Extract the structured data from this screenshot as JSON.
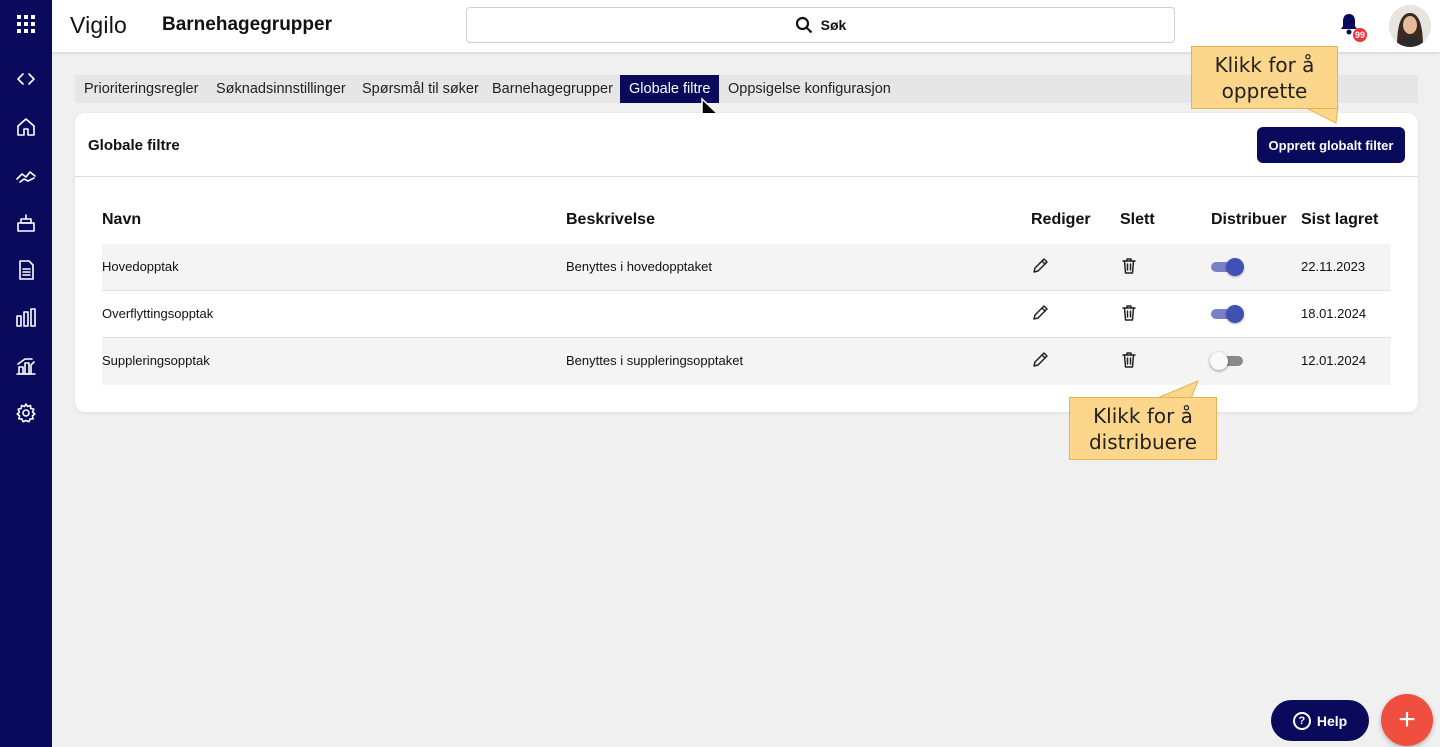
{
  "app": {
    "logo": "Vigilo",
    "page_title": "Barnehagegrupper"
  },
  "search": {
    "label": "Søk"
  },
  "notifications": {
    "count": "99"
  },
  "tabs": [
    {
      "label": "Prioriteringsregler",
      "active": false
    },
    {
      "label": "Søknadsinnstillinger",
      "active": false
    },
    {
      "label": "Spørsmål til søker",
      "active": false
    },
    {
      "label": "Barnehagegrupper",
      "active": false
    },
    {
      "label": "Globale filtre",
      "active": true
    },
    {
      "label": "Oppsigelse konfigurasjon",
      "active": false
    }
  ],
  "card": {
    "title": "Globale filtre",
    "create_button": "Opprett globalt filter"
  },
  "table": {
    "headers": {
      "name": "Navn",
      "description": "Beskrivelse",
      "edit": "Rediger",
      "delete": "Slett",
      "distribute": "Distribuer",
      "saved": "Sist lagret"
    },
    "rows": [
      {
        "name": "Hovedopptak",
        "description": "Benyttes i hovedopptaket",
        "distributed": true,
        "saved": "22.11.2023"
      },
      {
        "name": "Overflyttingsopptak",
        "description": "",
        "distributed": true,
        "saved": "18.01.2024"
      },
      {
        "name": "Suppleringsopptak",
        "description": "Benyttes i suppleringsopptaket",
        "distributed": false,
        "saved": "12.01.2024"
      }
    ]
  },
  "callouts": {
    "create": {
      "line1": "Klikk for å",
      "line2": "opprette"
    },
    "distribute": {
      "line1": "Klikk for å",
      "line2": "distribuere"
    }
  },
  "help_button": {
    "label": "Help",
    "glyph": "?"
  },
  "fab": {
    "glyph": "+"
  },
  "colors": {
    "navy": "#0a0a5c",
    "toggle_on": "#3f51b5",
    "fab": "#f04e3e",
    "callout": "#fcd68a"
  },
  "icons": [
    "apps-grid-icon",
    "code-icon",
    "home-icon",
    "hands-icon",
    "cake-icon",
    "document-icon",
    "bar-chart-icon",
    "buildings-chart-icon",
    "gear-icon",
    "search-icon",
    "bell-icon",
    "pencil-icon",
    "trash-icon"
  ]
}
